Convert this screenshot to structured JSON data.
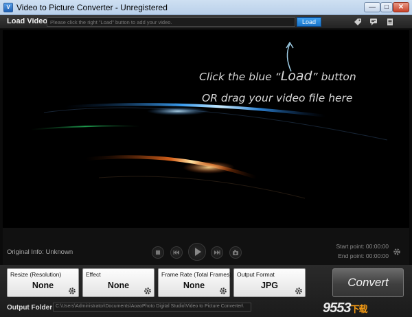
{
  "window": {
    "title": "Video to Picture Converter - Unregistered",
    "app_icon": "app-logo-icon",
    "controls": {
      "minimize": "—",
      "maximize": "□",
      "close": "✕"
    }
  },
  "load_bar": {
    "label": "Load Video:",
    "placeholder": "Please click the right \"Load\" button to add your video.",
    "load_button": "Load",
    "tools": [
      "tag-icon",
      "chat-icon",
      "document-icon"
    ]
  },
  "video_area": {
    "hint_line1_pre": "Click the blue “",
    "hint_load": "Load",
    "hint_line1_post": "” button",
    "hint_line2": "OR drag your video file here"
  },
  "controls": {
    "original_info": "Original Info: Unknown",
    "start_point": "Start point: 00:00:00",
    "end_point": "End point: 00:00:00",
    "buttons": [
      "stop-icon",
      "previous-icon",
      "play-icon",
      "next-icon",
      "snapshot-icon"
    ]
  },
  "options": [
    {
      "title": "Resize (Resolution)",
      "value": "None"
    },
    {
      "title": "Effect",
      "value": "None"
    },
    {
      "title": "Frame Rate (Total Frames)",
      "value": "None"
    },
    {
      "title": "Output Format",
      "value": "JPG"
    }
  ],
  "convert_button": "Convert",
  "output_folder": {
    "label": "Output Folder:",
    "path": "C:\\Users\\Administrator\\Documents\\AoaoPhoto Digital Studio\\Video to Picture Converter\\"
  },
  "watermark": {
    "main": "9553",
    "sub": "下载"
  }
}
